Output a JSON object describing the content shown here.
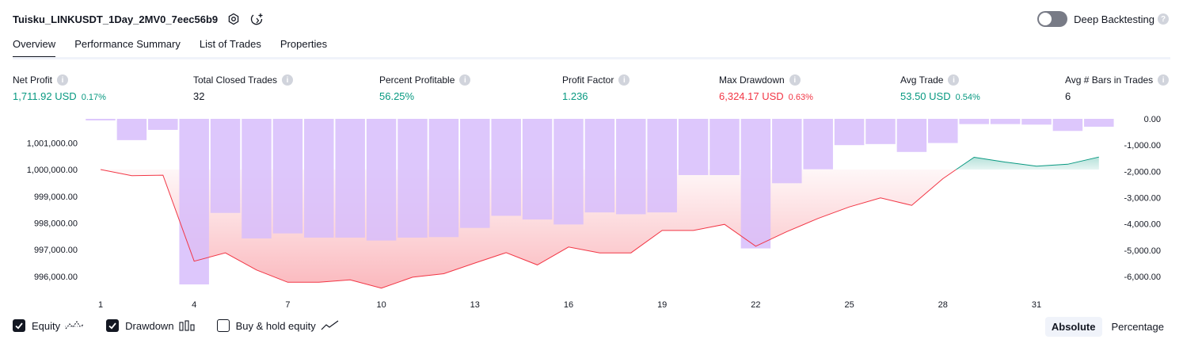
{
  "header": {
    "title": "Tuisku_LINKUSDT_1Day_2MV0_7eec56b9",
    "deep_backtesting_label": "Deep Backtesting",
    "deep_backtesting_enabled": false,
    "help_glyph": "?"
  },
  "tabs": [
    {
      "label": "Overview",
      "active": true
    },
    {
      "label": "Performance Summary",
      "active": false
    },
    {
      "label": "List of Trades",
      "active": false
    },
    {
      "label": "Properties",
      "active": false
    }
  ],
  "metrics": [
    {
      "label": "Net Profit",
      "value": "1,711.92 USD",
      "pct": "0.17%",
      "color": "#089981"
    },
    {
      "label": "Total Closed Trades",
      "value": "32",
      "pct": "",
      "color": "#131722"
    },
    {
      "label": "Percent Profitable",
      "value": "56.25%",
      "pct": "",
      "color": "#089981"
    },
    {
      "label": "Profit Factor",
      "value": "1.236",
      "pct": "",
      "color": "#089981"
    },
    {
      "label": "Max Drawdown",
      "value": "6,324.17 USD",
      "pct": "0.63%",
      "color": "#f23645"
    },
    {
      "label": "Avg Trade",
      "value": "53.50 USD",
      "pct": "0.54%",
      "color": "#089981"
    },
    {
      "label": "Avg # Bars in Trades",
      "value": "6",
      "pct": "",
      "color": "#131722"
    }
  ],
  "legend": {
    "equity_label": "Equity",
    "equity_checked": true,
    "drawdown_label": "Drawdown",
    "drawdown_checked": true,
    "buyhold_label": "Buy & hold equity",
    "buyhold_checked": false
  },
  "mode": {
    "absolute_label": "Absolute",
    "percentage_label": "Percentage",
    "selected": "Absolute"
  },
  "chart_data": {
    "type": "line",
    "x_ticks": [
      "1",
      "4",
      "7",
      "10",
      "13",
      "16",
      "19",
      "22",
      "25",
      "28",
      "31"
    ],
    "left_axis": {
      "ticks": [
        "1,001,000.00",
        "1,000,000.00",
        "999,000.00",
        "998,000.00",
        "997,000.00",
        "996,000.00"
      ],
      "range": [
        995700,
        1001900
      ]
    },
    "right_axis": {
      "ticks": [
        "0.00",
        "-1,000.00",
        "-2,000.00",
        "-3,000.00",
        "-4,000.00",
        "-5,000.00",
        "-6,000.00"
      ],
      "range": [
        -6300,
        0
      ]
    },
    "baseline": 1000000,
    "colors": {
      "equity_loss": "#f23645",
      "equity_profit": "#089981",
      "drawdown_bar": "#d7bdfb"
    },
    "series": [
      {
        "name": "Equity",
        "x": [
          1,
          2,
          3,
          4,
          5,
          6,
          7,
          8,
          9,
          10,
          11,
          12,
          13,
          14,
          15,
          16,
          17,
          18,
          19,
          20,
          21,
          22,
          23,
          24,
          25,
          26,
          27,
          28,
          29,
          30,
          31,
          32,
          33
        ],
        "values": [
          1000000,
          999770,
          999790,
          996570,
          996880,
          996240,
          995780,
          995780,
          995870,
          995560,
          995970,
          996100,
          996500,
          996890,
          996430,
          997100,
          996880,
          996880,
          997720,
          997720,
          997950,
          997130,
          997680,
          998170,
          998600,
          998940,
          998660,
          999660,
          1000460,
          1000280,
          1000130,
          1000200,
          1000470
        ]
      },
      {
        "name": "Drawdown",
        "x": [
          1,
          2,
          3,
          4,
          5,
          6,
          7,
          8,
          9,
          10,
          11,
          12,
          13,
          14,
          15,
          16,
          17,
          18,
          19,
          20,
          21,
          22,
          23,
          24,
          25,
          26,
          27,
          28,
          29,
          30,
          31,
          32,
          33
        ],
        "values": [
          -60,
          -810,
          -420,
          -6300,
          -3580,
          -4550,
          -4360,
          -4520,
          -4520,
          -4630,
          -4520,
          -4500,
          -4150,
          -3690,
          -3830,
          -4020,
          -3560,
          -3630,
          -3560,
          -2140,
          -2140,
          -4930,
          -2450,
          -1920,
          -1000,
          -960,
          -1260,
          -920,
          -200,
          -200,
          -220,
          -460,
          -300
        ]
      }
    ]
  }
}
